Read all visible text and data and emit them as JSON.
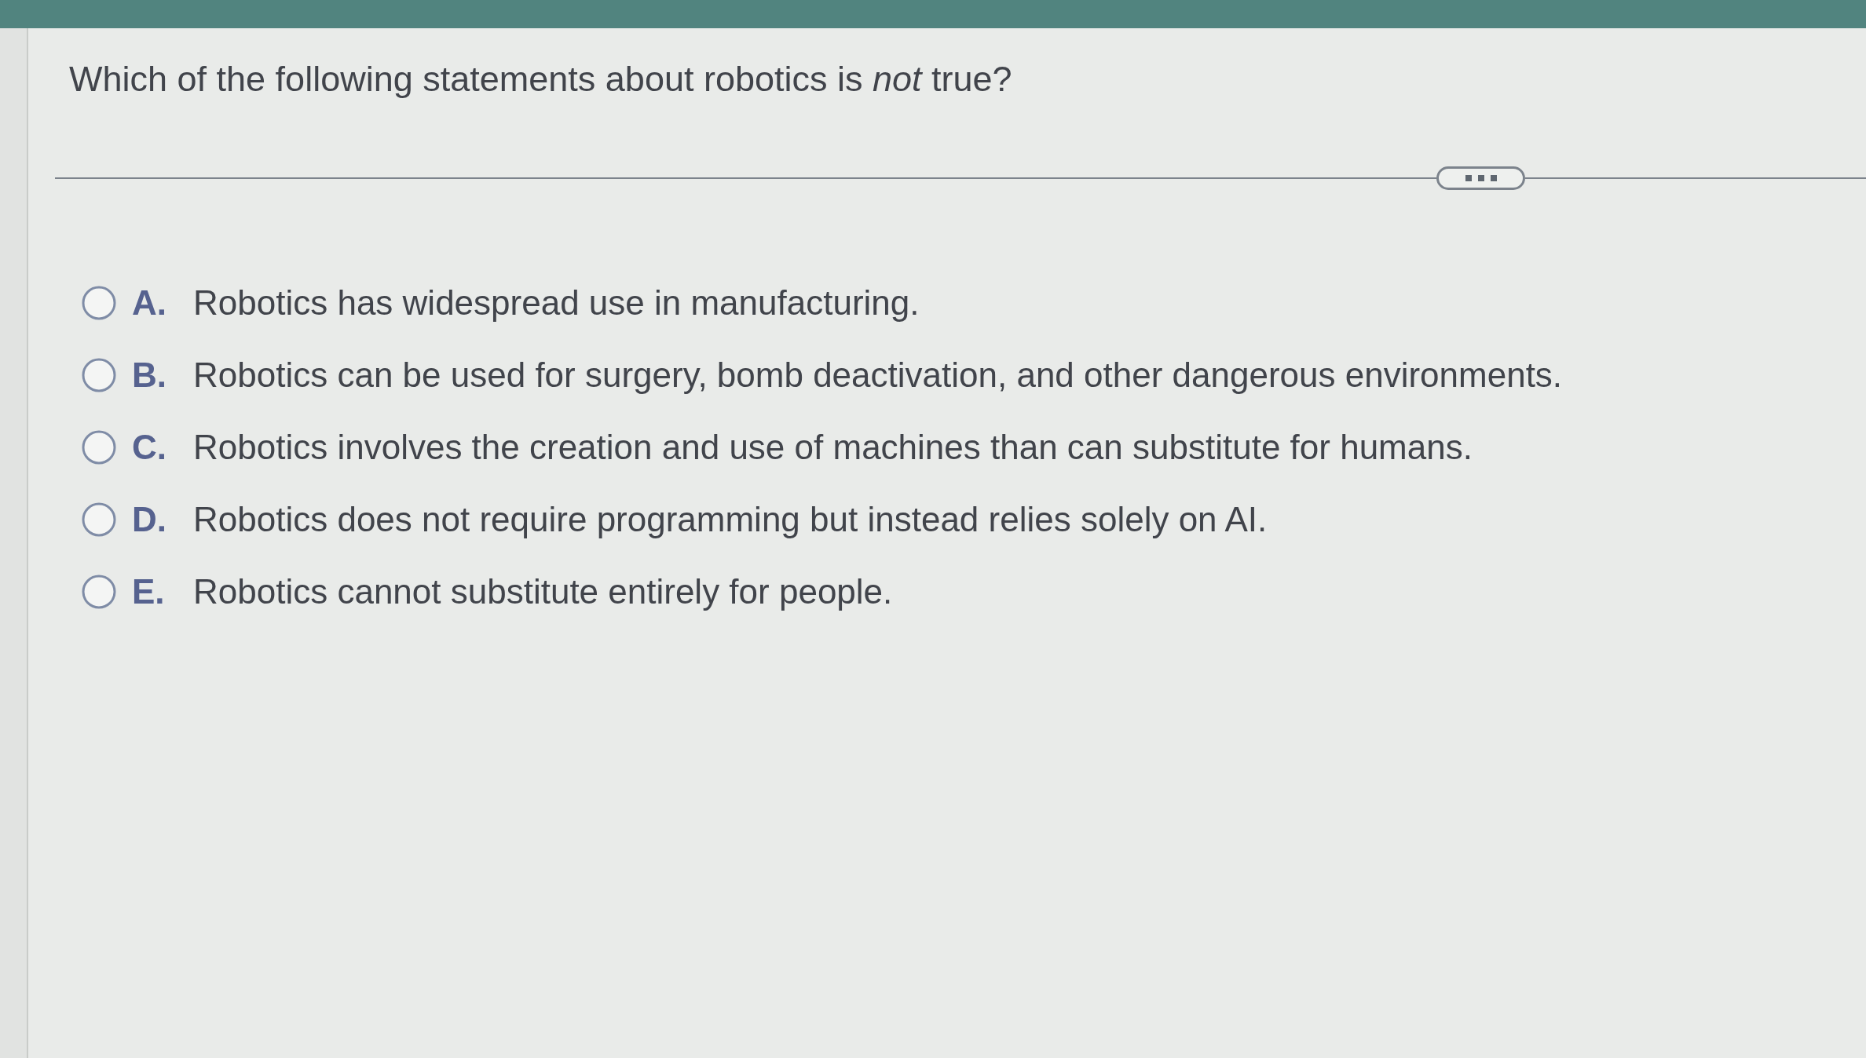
{
  "question": {
    "text": "Which of the following statements about robotics is *not* true?"
  },
  "options": [
    {
      "letter": "A.",
      "text": "Robotics has widespread use in manufacturing.",
      "selected": false
    },
    {
      "letter": "B.",
      "text": "Robotics can be used for surgery, bomb deactivation, and other dangerous environments.",
      "selected": false
    },
    {
      "letter": "C.",
      "text": "Robotics involves the creation and use of machines than can substitute for humans.",
      "selected": false
    },
    {
      "letter": "D.",
      "text": "Robotics does not require programming but instead relies solely on AI.",
      "selected": false
    },
    {
      "letter": "E.",
      "text": "Robotics cannot substitute entirely for people.",
      "selected": false
    }
  ]
}
